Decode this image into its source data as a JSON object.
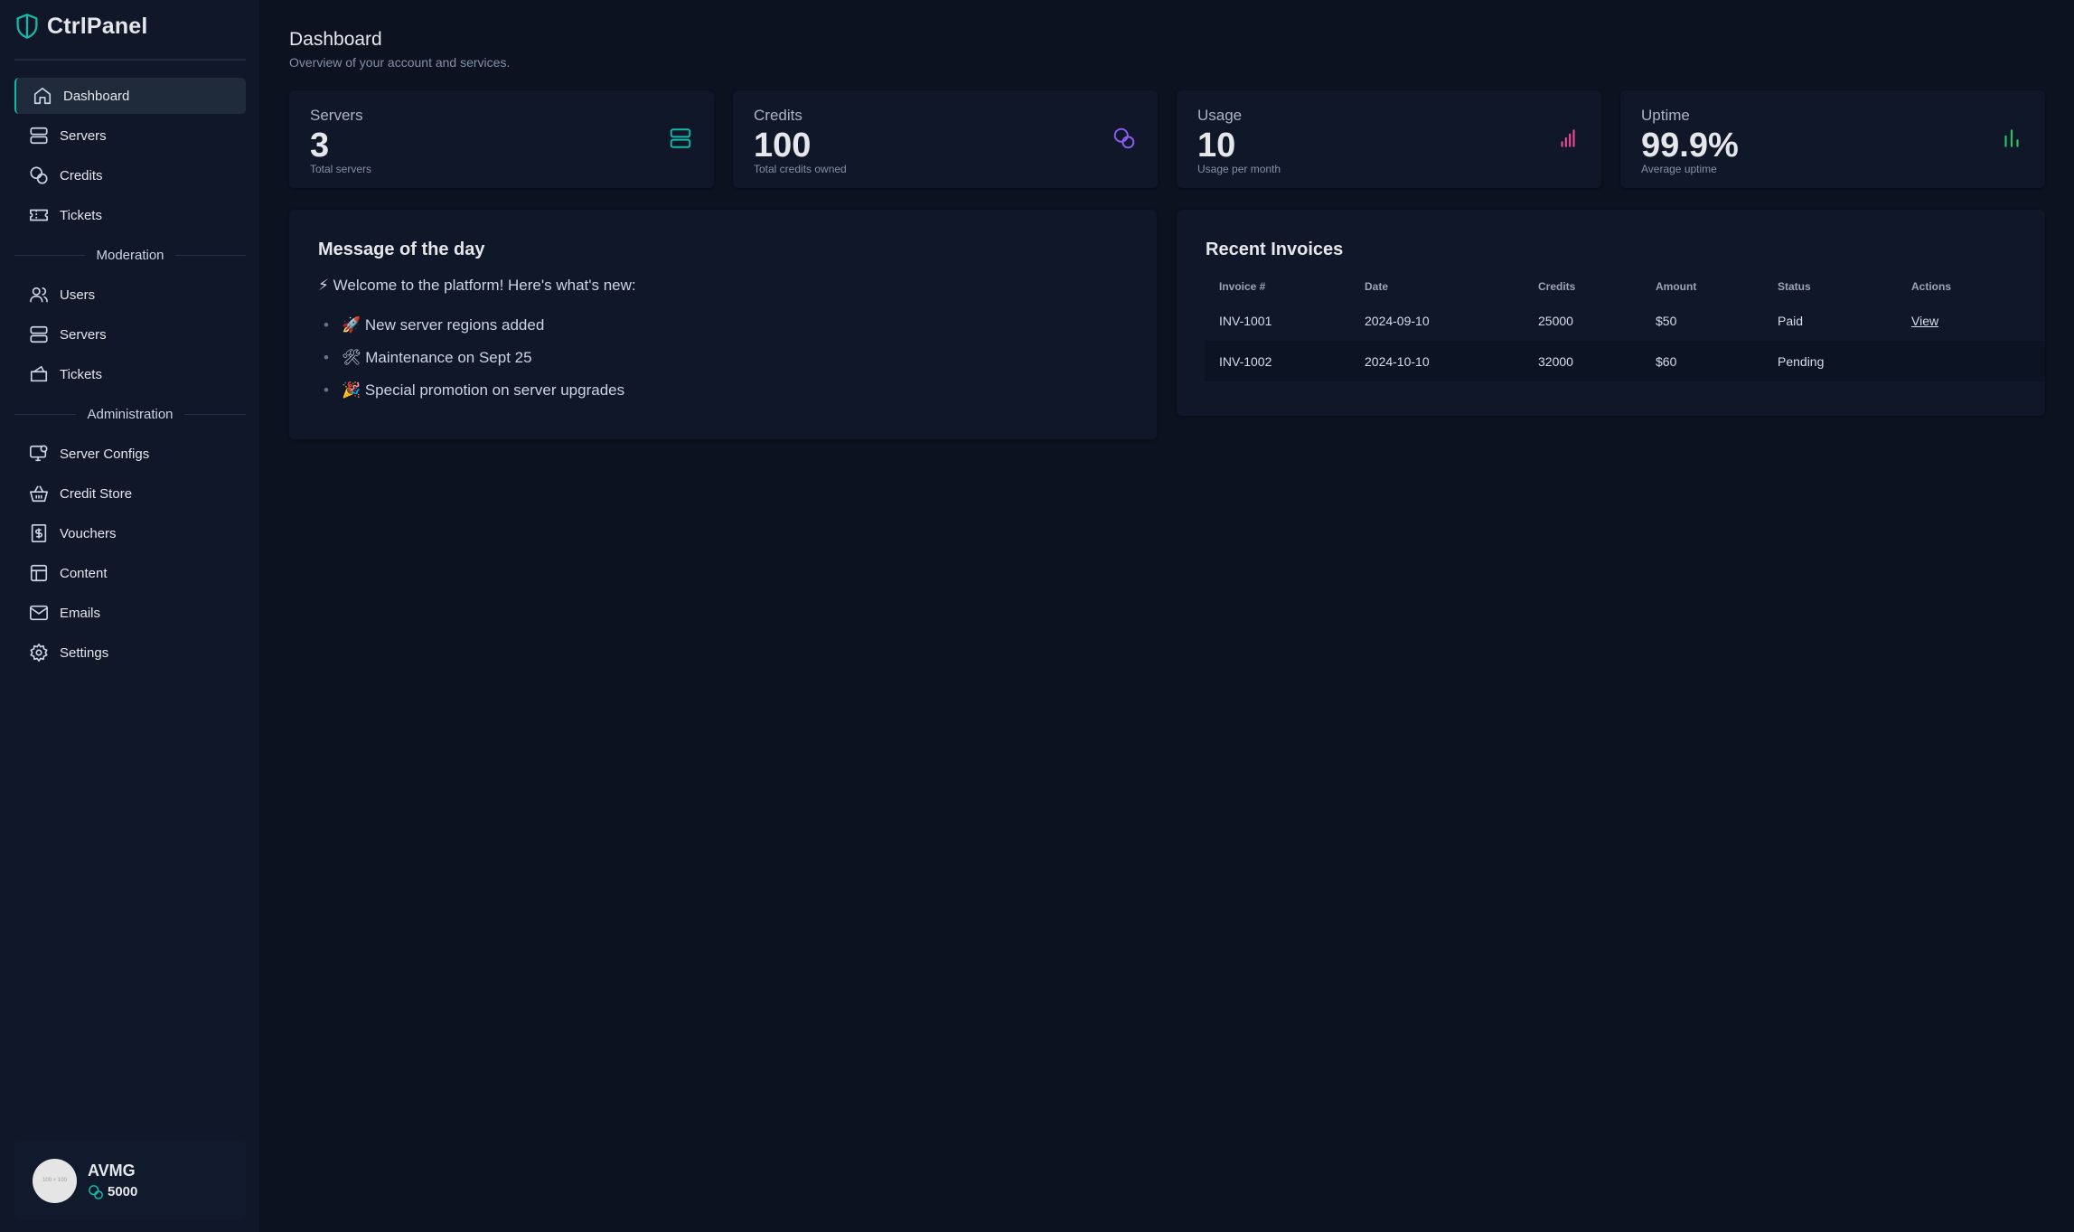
{
  "brand": {
    "name": "CtrlPanel"
  },
  "sidebar": {
    "main": [
      {
        "label": "Dashboard",
        "icon": "home-icon"
      },
      {
        "label": "Servers",
        "icon": "server-icon"
      },
      {
        "label": "Credits",
        "icon": "coins-icon"
      },
      {
        "label": "Tickets",
        "icon": "ticket-icon"
      }
    ],
    "moderation_title": "Moderation",
    "moderation": [
      {
        "label": "Users",
        "icon": "users-icon"
      },
      {
        "label": "Servers",
        "icon": "server-icon"
      },
      {
        "label": "Tickets",
        "icon": "tickets-icon"
      }
    ],
    "administration_title": "Administration",
    "administration": [
      {
        "label": "Server Configs",
        "icon": "monitor-cog-icon"
      },
      {
        "label": "Credit Store",
        "icon": "basket-icon"
      },
      {
        "label": "Vouchers",
        "icon": "dollar-receipt-icon"
      },
      {
        "label": "Content",
        "icon": "layout-icon"
      },
      {
        "label": "Emails",
        "icon": "mail-icon"
      },
      {
        "label": "Settings",
        "icon": "gear-icon"
      }
    ]
  },
  "user": {
    "name": "AVMG",
    "credits": "5000",
    "avatar_text": "100 × 100"
  },
  "header": {
    "title": "Dashboard",
    "subtitle": "Overview of your account and services."
  },
  "stats": [
    {
      "label": "Servers",
      "value": "3",
      "sub": "Total servers",
      "icon": "server-icon",
      "color": "#14b8a6"
    },
    {
      "label": "Credits",
      "value": "100",
      "sub": "Total credits owned",
      "icon": "coins-icon",
      "color": "#8b5cf6"
    },
    {
      "label": "Usage",
      "value": "10",
      "sub": "Usage per month",
      "icon": "bar-chart-icon",
      "color": "#ec4899"
    },
    {
      "label": "Uptime",
      "value": "99.9%",
      "sub": "Average uptime",
      "icon": "bar-chart-icon",
      "color": "#22c55e"
    }
  ],
  "motd": {
    "title": "Message of the day",
    "intro": "⚡ Welcome to the platform! Here's what's new:",
    "items": [
      "🚀 New server regions added",
      "🛠 Maintenance on Sept 25",
      "🎉 Special promotion on server upgrades"
    ]
  },
  "invoices": {
    "title": "Recent Invoices",
    "columns": [
      "Invoice #",
      "Date",
      "Credits",
      "Amount",
      "Status",
      "Actions"
    ],
    "rows": [
      {
        "id": "INV-1001",
        "date": "2024-09-10",
        "credits": "25000",
        "amount": "$50",
        "status": "Paid",
        "action": "View"
      },
      {
        "id": "INV-1002",
        "date": "2024-10-10",
        "credits": "32000",
        "amount": "$60",
        "status": "Pending",
        "action": ""
      }
    ]
  },
  "colors": {
    "accent": "#14b8a6",
    "paid": "#22c55e",
    "pending": "#f59e0b"
  }
}
